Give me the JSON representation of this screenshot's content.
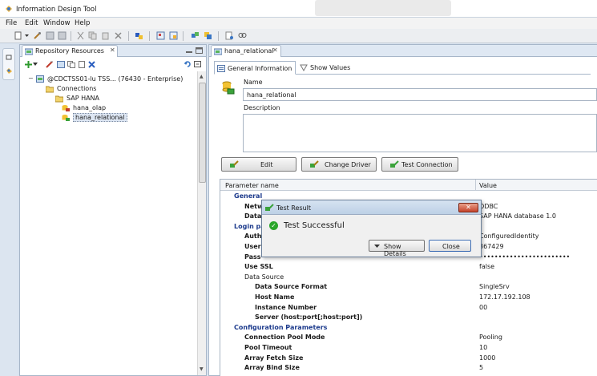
{
  "window": {
    "title": "Information Design Tool"
  },
  "menu": [
    "File",
    "Edit",
    "Window",
    "Help"
  ],
  "repository": {
    "tab_label": "Repository Resources",
    "tree": [
      {
        "label": "@CDCTSS01-lu TSS... (76430 - Enterprise)",
        "level": 0,
        "icon": "server-icon",
        "expander": "−"
      },
      {
        "label": "Connections",
        "level": 1,
        "icon": "folder-icon",
        "expander": ""
      },
      {
        "label": "SAP HANA",
        "level": 2,
        "icon": "folder-icon",
        "expander": ""
      },
      {
        "label": "hana_olap",
        "level": 3,
        "icon": "olap-connection-icon",
        "expander": ""
      },
      {
        "label": "hana_relational",
        "level": 3,
        "icon": "relational-connection-icon",
        "expander": "",
        "selected": true
      }
    ]
  },
  "editor": {
    "tab_label": "hana_relational",
    "subtabs": {
      "general": "General Information",
      "values": "Show Values"
    },
    "name_label": "Name",
    "name_value": "hana_relational",
    "description_label": "Description",
    "description_value": "",
    "buttons": {
      "edit": "Edit",
      "change_driver": "Change Driver",
      "test_connection": "Test Connection"
    },
    "table": {
      "col_name": "Parameter name",
      "col_value": "Value",
      "rows": [
        {
          "name": "General",
          "value": "",
          "style": "group"
        },
        {
          "name": "Netw",
          "value": "ODBC",
          "style": "bold"
        },
        {
          "name": "Data",
          "value": "SAP HANA database 1.0",
          "style": "bold"
        },
        {
          "name": "Login pa",
          "value": "",
          "style": "group"
        },
        {
          "name": "Auth",
          "value": "ConfiguredIdentity",
          "style": "bold"
        },
        {
          "name": "User",
          "value": "367429",
          "style": "bold"
        },
        {
          "name": "Pass",
          "value": "••••••••••••••••••••••••",
          "style": "bold"
        },
        {
          "name": "Use SSL",
          "value": "false",
          "style": "bold"
        },
        {
          "name": "Data Source",
          "value": "",
          "style": "plain"
        },
        {
          "name": "Data Source Format",
          "value": "SingleSrv",
          "style": "bold2"
        },
        {
          "name": "Host Name",
          "value": "172.17.192.108",
          "style": "bold2"
        },
        {
          "name": "Instance Number",
          "value": "00",
          "style": "bold2"
        },
        {
          "name": "Server (host:port[;host:port])",
          "value": "",
          "style": "bold2"
        },
        {
          "name": "Configuration Parameters",
          "value": "",
          "style": "group"
        },
        {
          "name": "Connection Pool Mode",
          "value": "Pooling",
          "style": "bold"
        },
        {
          "name": "Pool Timeout",
          "value": "10",
          "style": "bold"
        },
        {
          "name": "Array Fetch Size",
          "value": "1000",
          "style": "bold"
        },
        {
          "name": "Array Bind Size",
          "value": "5",
          "style": "bold"
        }
      ]
    }
  },
  "dialog": {
    "title": "Test Result",
    "message": "Test Successful",
    "show_details": "Show Details",
    "close": "Close",
    "close_x": "✕"
  },
  "colors": {
    "selection": "#dde6f3",
    "group_text": "#1c3a8c",
    "success": "#2aa62a"
  }
}
